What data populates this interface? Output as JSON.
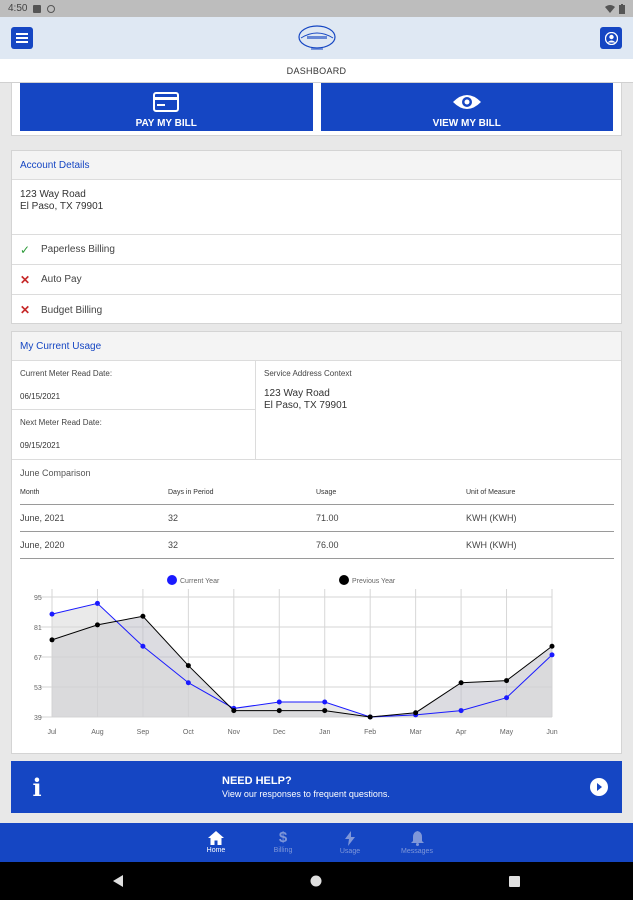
{
  "status": {
    "time": "4:50"
  },
  "header": {
    "subtitle": "DASHBOARD"
  },
  "bill": {
    "pay_label": "PAY MY BILL",
    "view_label": "VIEW MY BILL"
  },
  "account": {
    "title": "Account Details",
    "address_line1": "123 Way Road",
    "address_line2": "El Paso, TX 79901",
    "features": [
      {
        "label": "Paperless Billing",
        "enabled": true
      },
      {
        "label": "Auto Pay",
        "enabled": false
      },
      {
        "label": "Budget Billing",
        "enabled": false
      }
    ]
  },
  "usage": {
    "title": "My Current Usage",
    "current_read_label": "Current Meter Read Date:",
    "current_read_value": "06/15/2021",
    "next_read_label": "Next Meter Read Date:",
    "next_read_value": "09/15/2021",
    "service_label": "Service Address Context",
    "service_line1": "123 Way Road",
    "service_line2": "El Paso, TX 79901",
    "comparison_title": "June Comparison",
    "columns": [
      "Month",
      "Days in Period",
      "Usage",
      "Unit of Measure"
    ],
    "rows": [
      [
        "June, 2021",
        "32",
        "71.00",
        "KWH (KWH)"
      ],
      [
        "June, 2020",
        "32",
        "76.00",
        "KWH (KWH)"
      ]
    ]
  },
  "chart_data": {
    "type": "line",
    "categories": [
      "Jul",
      "Aug",
      "Sep",
      "Oct",
      "Nov",
      "Dec",
      "Jan",
      "Feb",
      "Mar",
      "Apr",
      "May",
      "Jun"
    ],
    "series": [
      {
        "name": "Current Year",
        "color": "#1a1aff",
        "values": [
          87,
          92,
          72,
          55,
          43,
          46,
          46,
          39,
          40,
          42,
          48,
          68
        ]
      },
      {
        "name": "Previous Year",
        "color": "#000000",
        "values": [
          75,
          82,
          86,
          63,
          42,
          42,
          42,
          39,
          41,
          55,
          56,
          72
        ]
      }
    ],
    "yticks": [
      39,
      53,
      67,
      81,
      95
    ],
    "ylim": [
      39,
      95
    ],
    "legend": "top",
    "grid": true
  },
  "help": {
    "title": "NEED HELP?",
    "subtitle": "View our responses to frequent questions."
  },
  "tabs": [
    {
      "label": "Home",
      "icon": "home-icon",
      "active": true
    },
    {
      "label": "Billing",
      "icon": "dollar-icon",
      "active": false
    },
    {
      "label": "Usage",
      "icon": "lightning-icon",
      "active": false
    },
    {
      "label": "Messages",
      "icon": "bell-icon",
      "active": false
    }
  ],
  "colors": {
    "brand": "#1546c3",
    "check": "#2e9b3a",
    "cross": "#c62828"
  }
}
